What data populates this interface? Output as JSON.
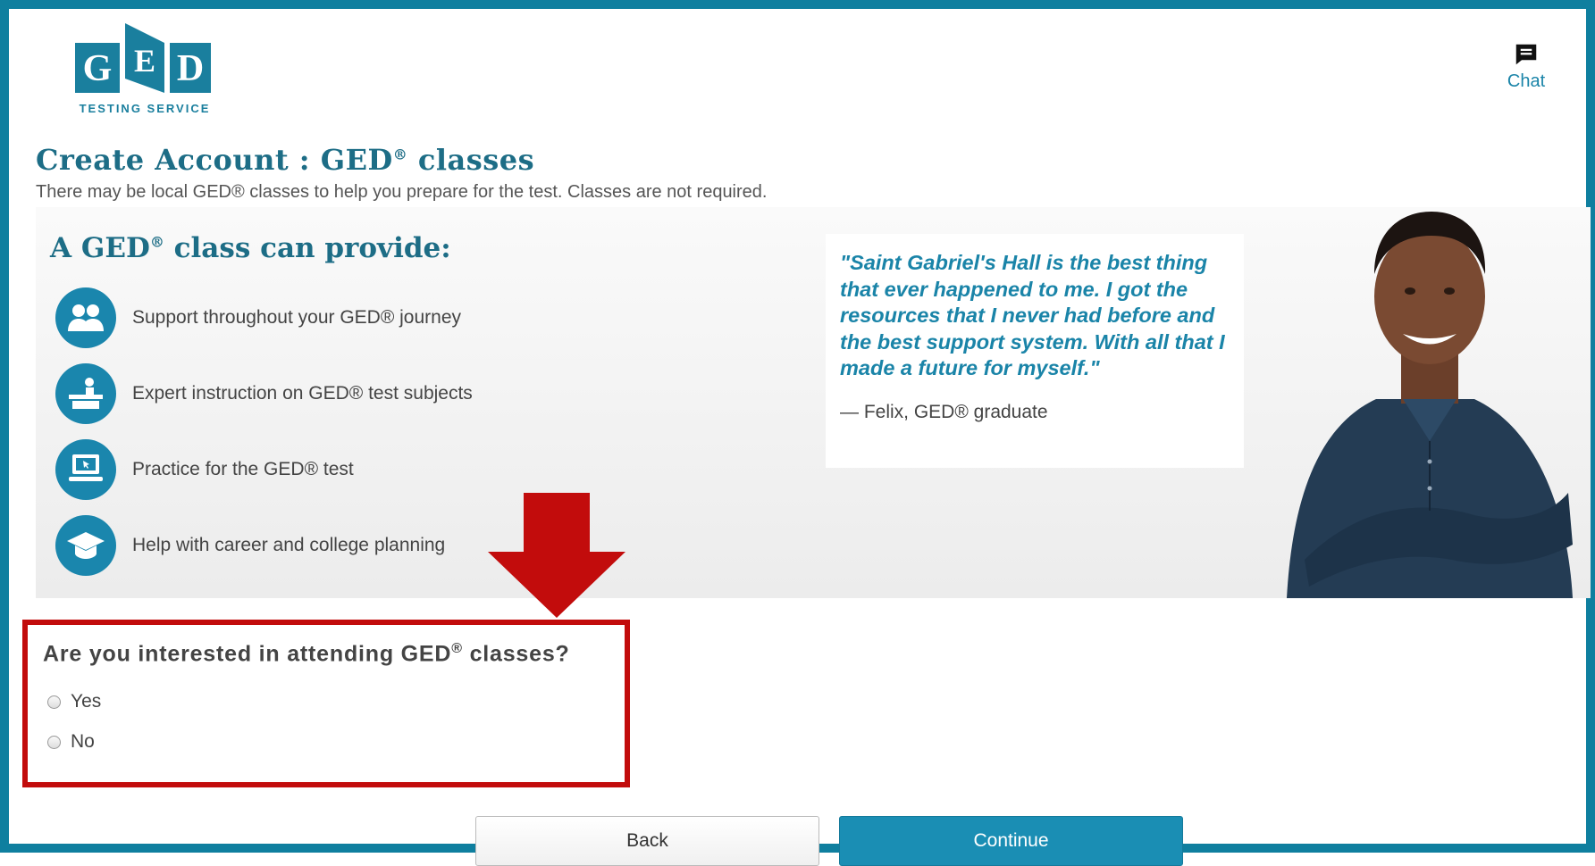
{
  "header": {
    "logo_letters": [
      "G",
      "E",
      "D"
    ],
    "logo_subtitle": "TESTING SERVICE",
    "chat_label": "Chat"
  },
  "page": {
    "title_main": "Create Account : GED",
    "title_reg": "®",
    "title_tail": " classes",
    "subtitle": "There may be local GED® classes to help you prepare for the test. Classes are not required."
  },
  "panel": {
    "heading_main": "A GED",
    "heading_reg": "®",
    "heading_tail": " class can provide:",
    "benefits": [
      {
        "icon": "group-icon",
        "label": "Support throughout your GED® journey"
      },
      {
        "icon": "instructor-icon",
        "label": "Expert instruction on GED® test subjects"
      },
      {
        "icon": "computer-icon",
        "label": "Practice for the GED® test"
      },
      {
        "icon": "graduation-cap-icon",
        "label": "Help with career and college planning"
      }
    ],
    "quote": "\"Saint Gabriel's Hall is the best thing that ever happened to me. I got the resources that I never had before and the best support system. With all that I made a future for myself.\"",
    "quote_attribution": "— Felix, GED® graduate"
  },
  "question": {
    "text_main": "Are you interested in attending GED",
    "text_reg": "®",
    "text_tail": " classes?",
    "options": [
      "Yes",
      "No"
    ],
    "selected": null
  },
  "buttons": {
    "back": "Back",
    "continue": "Continue"
  },
  "colors": {
    "brand_teal": "#1a84a8",
    "heading": "#1d6d86",
    "highlight_red": "#c20c0c",
    "frame": "#0f7f9f"
  }
}
